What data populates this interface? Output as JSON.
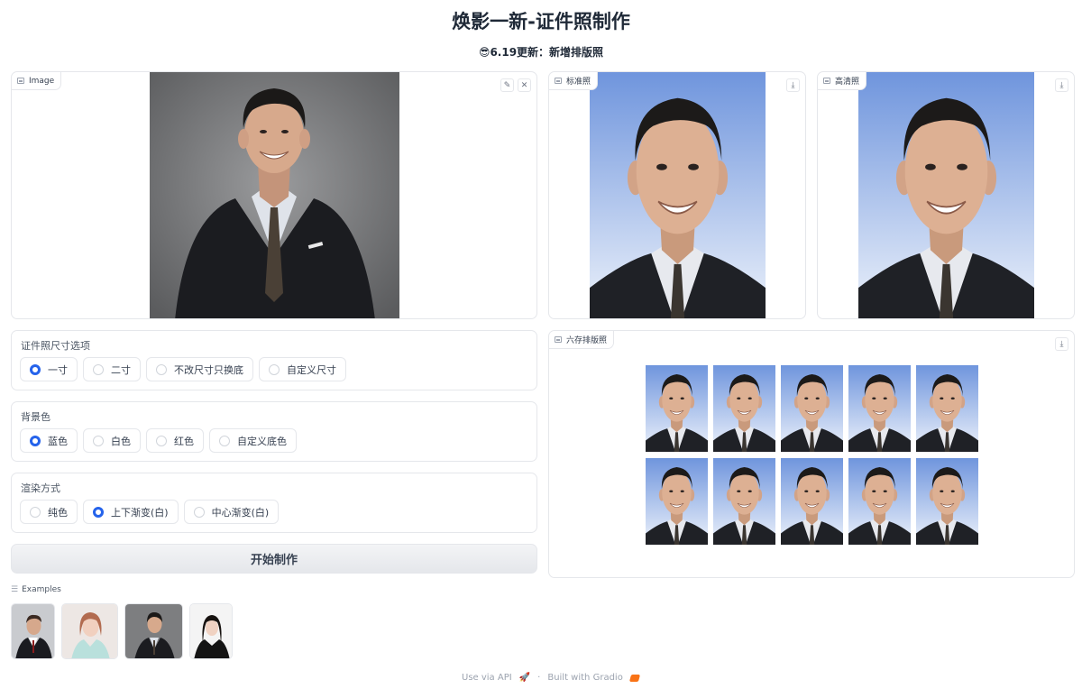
{
  "header": {
    "title": "焕影一新-证件照制作",
    "subtitle": "😎6.19更新：新增排版照"
  },
  "input_panel": {
    "label": "Image",
    "edit_icon": "pencil-icon",
    "clear_icon": "close-icon"
  },
  "standard_panel": {
    "label": "标准照",
    "download_icon": "download-icon"
  },
  "hd_panel": {
    "label": "高清照",
    "download_icon": "download-icon"
  },
  "layout_panel": {
    "label": "六存排版照",
    "download_icon": "download-icon"
  },
  "size_options": {
    "label": "证件照尺寸选项",
    "options": [
      {
        "label": "一寸",
        "selected": true
      },
      {
        "label": "二寸",
        "selected": false
      },
      {
        "label": "不改尺寸只换底",
        "selected": false
      },
      {
        "label": "自定义尺寸",
        "selected": false
      }
    ]
  },
  "background": {
    "label": "背景色",
    "options": [
      {
        "label": "蓝色",
        "selected": true
      },
      {
        "label": "白色",
        "selected": false
      },
      {
        "label": "红色",
        "selected": false
      },
      {
        "label": "自定义底色",
        "selected": false
      }
    ]
  },
  "render": {
    "label": "渲染方式",
    "options": [
      {
        "label": "纯色",
        "selected": false
      },
      {
        "label": "上下渐变(白)",
        "selected": true
      },
      {
        "label": "中心渐变(白)",
        "selected": false
      }
    ]
  },
  "submit_label": "开始制作",
  "examples": {
    "label": "Examples"
  },
  "footer": {
    "api": "Use via API",
    "separator": "·",
    "built": "Built with Gradio"
  },
  "colors": {
    "accent": "#2563eb",
    "blue_bg_top": "#6f95dd",
    "blue_bg_bottom": "#eef3fb"
  }
}
